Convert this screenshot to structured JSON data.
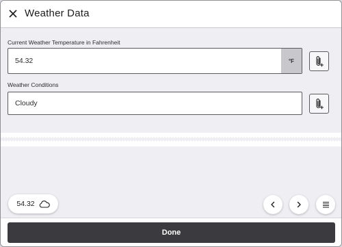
{
  "header": {
    "title": "Weather Data",
    "close_icon": "close-icon"
  },
  "fields": {
    "temperature": {
      "label": "Current Weather Temperature in Fahrenheit",
      "value": "54.32",
      "unit": "°F",
      "attach_icon": "attachment-icon"
    },
    "conditions": {
      "label": "Weather Conditions",
      "value": "Cloudy",
      "attach_icon": "attachment-icon"
    }
  },
  "summary_pill": {
    "value": "54.32",
    "icon": "cloud-icon"
  },
  "nav": {
    "prev_icon": "chevron-left-icon",
    "next_icon": "chevron-right-icon",
    "menu_icon": "list-icon"
  },
  "footer": {
    "done_label": "Done"
  },
  "colors": {
    "background": "#efeef3",
    "done_button": "#3a3a3f",
    "unit_badge": "#c8c8cc"
  }
}
